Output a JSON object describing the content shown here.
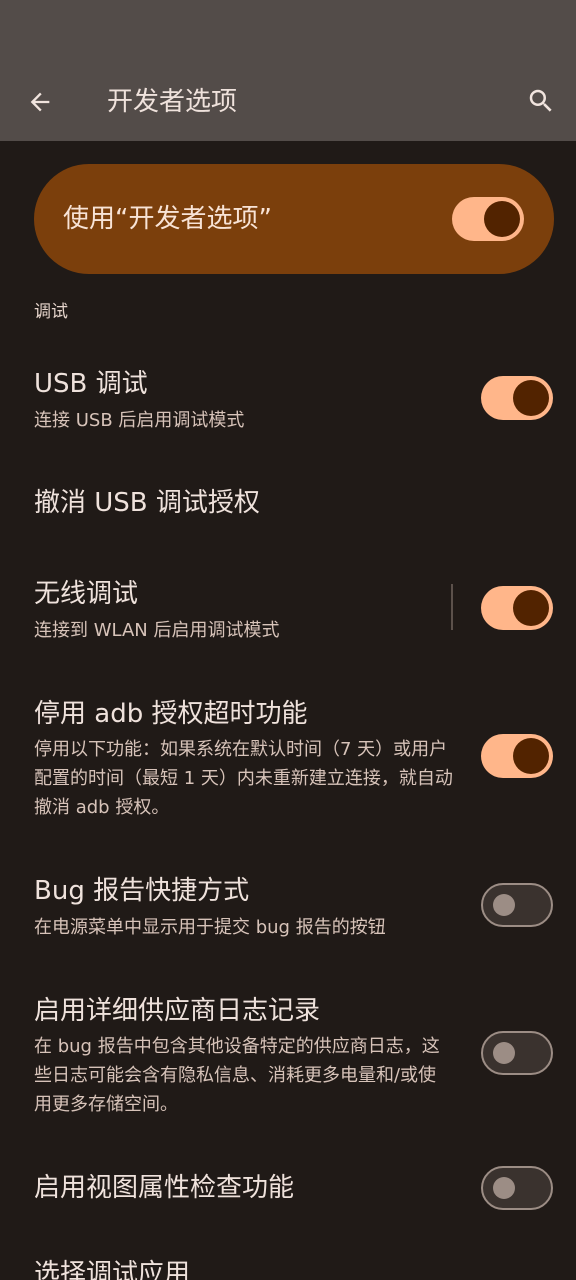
{
  "toolbar": {
    "title": "开发者选项",
    "back_icon": "arrow-back-icon",
    "search_icon": "search-icon"
  },
  "master": {
    "label": "使用“开发者选项”",
    "enabled": true
  },
  "section": {
    "header": "调试"
  },
  "settings": [
    {
      "title": "USB 调试",
      "summary": "连接 USB 后启用调试模式",
      "toggle": "on"
    },
    {
      "title": "撤消 USB 调试授权",
      "summary": "",
      "toggle": "none"
    },
    {
      "title": "无线调试",
      "summary": "连接到 WLAN 后启用调试模式",
      "toggle": "on"
    },
    {
      "title": "停用 adb 授权超时功能",
      "summary": "停用以下功能：如果系统在默认时间（7 天）或用户配置的时间（最短 1 天）内未重新建立连接，就自动撤消 adb 授权。",
      "toggle": "on"
    },
    {
      "title": "Bug 报告快捷方式",
      "summary": "在电源菜单中显示用于提交 bug 报告的按钮",
      "toggle": "off"
    },
    {
      "title": "启用详细供应商日志记录",
      "summary": "在 bug 报告中包含其他设备特定的供应商日志，这些日志可能会含有隐私信息、消耗更多电量和/或使用更多存储空间。",
      "toggle": "off"
    },
    {
      "title": "启用视图属性检查功能",
      "summary": "",
      "toggle": "off"
    },
    {
      "title": "选择调试应用",
      "summary": "",
      "toggle": "none"
    }
  ],
  "colors": {
    "background": "#201a17",
    "toolbar": "#534c49",
    "master_card": "#7b3f0c",
    "switch_on_track": "#ffb68a",
    "switch_on_thumb": "#522300",
    "switch_off_outline": "#9c8d85"
  }
}
